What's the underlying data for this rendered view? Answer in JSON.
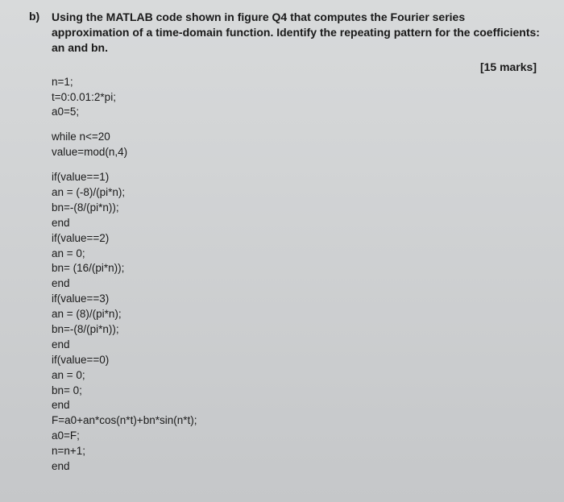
{
  "question": {
    "label": "b)",
    "text": "Using the MATLAB code shown in figure Q4 that computes the Fourier series approximation of a time-domain function. Identify the repeating pattern for the coefficients: an and bn.",
    "marks": "[15 marks]"
  },
  "code": {
    "block1": {
      "l1": "n=1;",
      "l2": "t=0:0.01:2*pi;",
      "l3": "a0=5;"
    },
    "block2": {
      "l1": "while n<=20",
      "l2": "value=mod(n,4)"
    },
    "block3": {
      "l1": "if(value==1)",
      "l2": "an = (-8)/(pi*n);",
      "l3": "bn=-(8/(pi*n));",
      "l4": "end",
      "l5": "if(value==2)",
      "l6": "an = 0;",
      "l7": "bn= (16/(pi*n));",
      "l8": "end",
      "l9": "if(value==3)",
      "l10": "an = (8)/(pi*n);",
      "l11": "bn=-(8/(pi*n));",
      "l12": "end",
      "l13": "if(value==0)",
      "l14": "an = 0;",
      "l15": "bn= 0;",
      "l16": "end",
      "l17": "F=a0+an*cos(n*t)+bn*sin(n*t);",
      "l18": "a0=F;",
      "l19": "n=n+1;",
      "l20": "end"
    }
  }
}
